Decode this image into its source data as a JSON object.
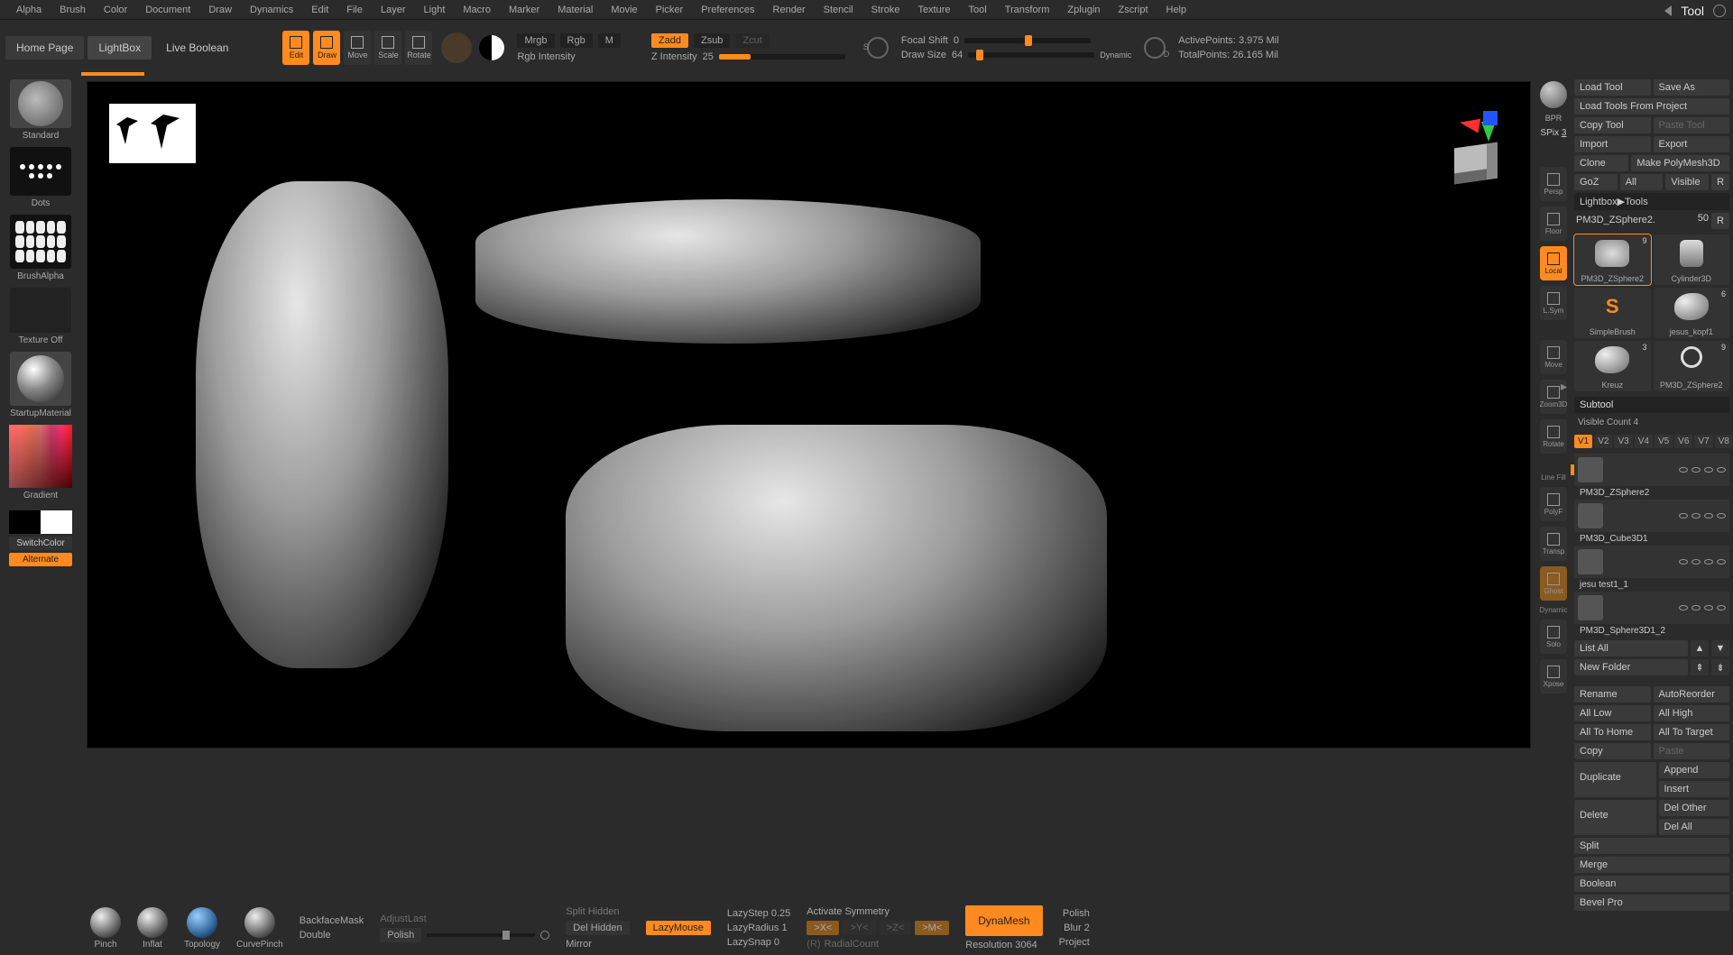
{
  "menu": [
    "Alpha",
    "Brush",
    "Color",
    "Document",
    "Draw",
    "Dynamics",
    "Edit",
    "File",
    "Layer",
    "Light",
    "Macro",
    "Marker",
    "Material",
    "Movie",
    "Picker",
    "Preferences",
    "Render",
    "Stencil",
    "Stroke",
    "Texture",
    "Tool",
    "Transform",
    "Zplugin",
    "Zscript",
    "Help"
  ],
  "title_right": "Tool",
  "tabs": {
    "home": "Home Page",
    "lightbox": "LightBox",
    "liveboolean": "Live Boolean"
  },
  "toolbar": {
    "edit": "Edit",
    "draw": "Draw",
    "move": "Move",
    "scale": "Scale",
    "rotate": "Rotate",
    "mrgb": "Mrgb",
    "rgb": "Rgb",
    "m": "M",
    "rgb_int": "Rgb Intensity",
    "zadd": "Zadd",
    "zsub": "Zsub",
    "zcut": "Zcut",
    "z_int": "Z Intensity",
    "z_int_val": "25",
    "focal": "Focal Shift",
    "focal_val": "0",
    "drawsize": "Draw Size",
    "drawsize_val": "64",
    "dynamic": "Dynamic",
    "active": "ActivePoints:",
    "active_val": "3.975 Mil",
    "total": "TotalPoints:",
    "total_val": "26.165 Mil"
  },
  "left": {
    "standard": "Standard",
    "dots": "Dots",
    "brushalpha": "BrushAlpha",
    "textureoff": "Texture Off",
    "startupmat": "StartupMaterial",
    "gradient": "Gradient",
    "switchcolor": "SwitchColor",
    "alternate": "Alternate"
  },
  "side": {
    "bpr": "BPR",
    "spix": "SPix",
    "spix_val": "3",
    "persp": "Persp",
    "floor": "Floor",
    "local": "Local",
    "lsym": "L.Sym",
    "move": "Move",
    "zoom": "Zoom3D",
    "rotate": "Rotate",
    "linefill": "Line Fill",
    "polyf": "PolyF",
    "transp": "Transp",
    "ghost": "Ghost",
    "dynamic": "Dynamic",
    "solo": "Solo",
    "xpose": "Xpose"
  },
  "right": {
    "load": "Load Tool",
    "saveas": "Save As",
    "loadproj": "Load Tools From Project",
    "copytool": "Copy Tool",
    "pastetool": "Paste Tool",
    "import": "Import",
    "export": "Export",
    "clone": "Clone",
    "makepoly": "Make PolyMesh3D",
    "goz": "GoZ",
    "all": "All",
    "visible": "Visible",
    "r": "R",
    "lightbox_tools": "Lightbox▶Tools",
    "toolname": "PM3D_ZSphere2.",
    "toolnum": "50",
    "tools": [
      {
        "name": "PM3D_ZSphere2",
        "num": "9",
        "shape": "crown",
        "sel": true
      },
      {
        "name": "Cylinder3D",
        "num": "",
        "shape": "cyl"
      },
      {
        "name": "SimpleBrush",
        "num": "",
        "shape": "sbrush"
      },
      {
        "name": "jesus_kopf1",
        "num": "6",
        "shape": "smudge"
      },
      {
        "name": "Kreuz",
        "num": "3",
        "shape": "smudge"
      },
      {
        "name": "PM3D_ZSphere2",
        "num": "9",
        "shape": "ring"
      }
    ],
    "subtool": "Subtool",
    "viscount": "Visible Count",
    "viscount_val": "4",
    "vtabs": [
      "V1",
      "V2",
      "V3",
      "V4",
      "V5",
      "V6",
      "V7",
      "V8"
    ],
    "subtools": [
      "PM3D_ZSphere2",
      "PM3D_Cube3D1",
      "jesu test1_1",
      "PM3D_Sphere3D1_2"
    ],
    "listall": "List All",
    "newfolder": "New Folder",
    "rename": "Rename",
    "autoreorder": "AutoReorder",
    "alllow": "All Low",
    "allhigh": "All High",
    "alltohome": "All To Home",
    "alltotarget": "All To Target",
    "copy": "Copy",
    "paste": "Paste",
    "duplicate": "Duplicate",
    "append": "Append",
    "insert": "Insert",
    "delete": "Delete",
    "delother": "Del Other",
    "delall": "Del All",
    "split": "Split",
    "merge": "Merge",
    "boolean": "Boolean",
    "bevelpro": "Bevel Pro"
  },
  "bottom": {
    "pinch": "Pinch",
    "inflat": "Inflat",
    "topology": "Topology",
    "curvepinch": "CurvePinch",
    "backfacemask": "BackfaceMask",
    "double": "Double",
    "adjustlast": "AdjustLast",
    "polish": "Polish",
    "splithidden": "Split Hidden",
    "delhidden": "Del Hidden",
    "mirror": "Mirror",
    "lazymouse": "LazyMouse",
    "lazystep": "LazyStep",
    "lazystep_val": "0.25",
    "lazyradius": "LazyRadius",
    "lazyradius_val": "1",
    "lazysnap": "LazySnap",
    "lazysnap_val": "0",
    "actsym": "Activate Symmetry",
    "x": ">X<",
    "y": ">Y<",
    "z": ">Z<",
    "m": ">M<",
    "r": "(R)",
    "radialcount": "RadialCount",
    "dynamesh": "DynaMesh",
    "resolution": "Resolution",
    "resolution_val": "3064",
    "blur": "Blur",
    "blur_val": "2",
    "polish2": "Polish",
    "project": "Project"
  }
}
